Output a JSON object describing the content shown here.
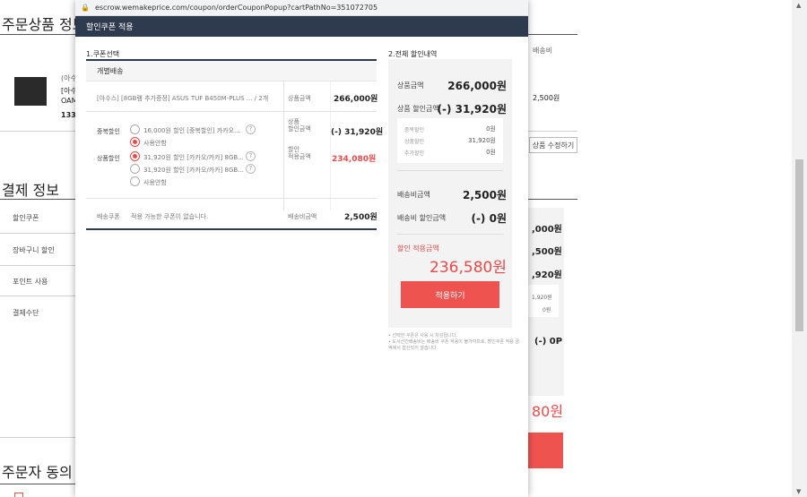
{
  "background": {
    "order_title": "주문상품 정보",
    "payment_title": "결제 정보",
    "consent_title": "주문자 동의",
    "shipping_col": "배송비",
    "product_seller": "(아수스",
    "product_line1": "[아수",
    "product_line2": "OAM",
    "product_price": "133,",
    "shipping_fee": "2,500원",
    "modify_button": "상품 수정하기",
    "payment_rows": [
      "할인쿠폰",
      "장바구니 할인",
      "포인트 사용",
      "결제수단"
    ],
    "right_values": [
      ",000원",
      ",500원",
      ",920원"
    ],
    "right_sub_values": [
      "1,920원",
      "0원"
    ],
    "right_zero": "(-) 0P",
    "right_total_fragment": "80원"
  },
  "popup": {
    "url": "escrow.wemakeprice.com/coupon/orderCouponPopup?cartPathNo=351072705",
    "title": "할인쿠폰 적용",
    "section1": "1.쿠폰선택",
    "section2": "2.전체 할인내역",
    "group_label": "개별배송",
    "item_name": "[아수스] [8GB램 추가증정] ASUS TUF B450M-PLUS ... / 2개",
    "item_price_label": "상품금액",
    "item_price": "266,000원",
    "dup_label": "중복할인",
    "dup_opt1": "16,000원 할인 [중복할인] 카카오...",
    "dup_opt2": "사용안함",
    "prod_label": "상품할인",
    "prod_opt1": "31,920원 할인 [카카오/카카] 8GB...",
    "prod_opt2": "31,920원 할인 [카카오/카카] 8GB...",
    "prod_opt3": "사용안함",
    "disc_label": "상품\n할인금액",
    "disc_value": "(-) 31,920원",
    "applied_label": "할인\n적용금액",
    "applied_value": "234,080원",
    "ship_coupon_label": "배송쿠폰",
    "ship_coupon_text": "적용 가능한 쿠폰이 없습니다.",
    "ship_fee_label": "배송비금액",
    "ship_fee_value": "2,500원"
  },
  "summary": {
    "goods_label": "상품금액",
    "goods_value": "266,000원",
    "goods_disc_label": "상품 할인금액",
    "goods_disc_value": "(-) 31,920원",
    "sub": [
      {
        "label": "중복할인",
        "value": "0원"
      },
      {
        "label": "상품할인",
        "value": "31,920원"
      },
      {
        "label": "추가할인",
        "value": "0원"
      }
    ],
    "ship_label": "배송비금액",
    "ship_value": "2,500원",
    "ship_disc_label": "배송비 할인금액",
    "ship_disc_value": "(-) 0원",
    "total_label": "할인 적용금액",
    "total_value": "236,580원",
    "apply_button": "적용하기",
    "notes": [
      "• 선택한 쿠폰은 사용 시 차감됩니다.",
      "• 도서산간배송비는 배송비 쿠폰 적용이 불가하므로, 할인쿠폰 적용 금액에서 합산되지 않습니다."
    ]
  },
  "colors": {
    "header_bg": "#2e3a4d",
    "accent_red": "#ef5350"
  }
}
